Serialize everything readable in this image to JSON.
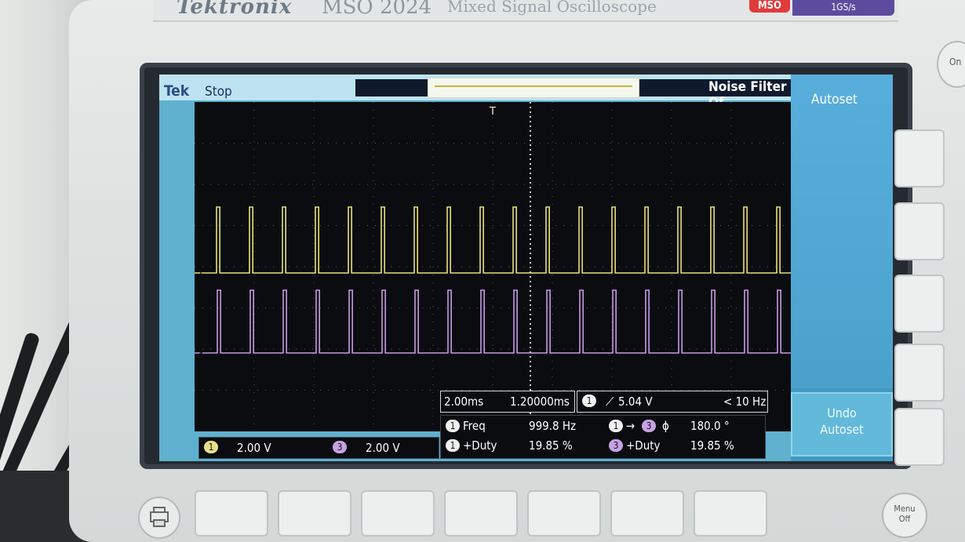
{
  "header": {
    "brand": "Tektronix",
    "model": "MSO 2024",
    "subtitle": "Mixed Signal Oscilloscope",
    "badge_mso": "MSO",
    "badge_rate": "1GS/s"
  },
  "status": {
    "tek": "Tek",
    "run_state": "Stop",
    "noise_filter": "Noise Filter Of"
  },
  "side_menu": {
    "autoset_top": "Autoset",
    "undo_autoset": "Undo\nAutoset"
  },
  "channels": {
    "ch1_label": "1",
    "ch1_scale": "2.00 V",
    "ch3_label": "3",
    "ch3_scale": "2.00 V",
    "ch1_marker": "1",
    "ch3_marker": "3",
    "trigger_marker": "T"
  },
  "horizontal": {
    "time_per_div": "2.00ms",
    "position": "1.20000ms"
  },
  "trigger": {
    "source": "1",
    "level": "5.04 V",
    "freq": "< 10 Hz"
  },
  "measurements": {
    "m1_src": "1",
    "m1_name": "Freq",
    "m1_value": "999.8 Hz",
    "m2_src": "1",
    "m2_name": "+Duty",
    "m2_value": "19.85 %",
    "m3_src_a": "1",
    "m3_src_b": "3",
    "m3_name": "ϕ",
    "m3_value": "180.0 °",
    "m4_src": "3",
    "m4_name": "+Duty",
    "m4_value": "19.85 %"
  },
  "buttons": {
    "menu_off": "Menu\nOff",
    "power": "On"
  },
  "colors": {
    "ch1_trace": "#e8e07a",
    "ch3_trace": "#c89ae8",
    "screen_bg": "#0b0c10",
    "menu_blue": "#58aedc"
  },
  "waveforms": {
    "ch1": {
      "duty_percent": 19.85,
      "frequency_hz": 999.8
    },
    "ch3": {
      "duty_percent": 19.85,
      "frequency_hz": 999.8,
      "phase_deg": 180.0
    }
  }
}
